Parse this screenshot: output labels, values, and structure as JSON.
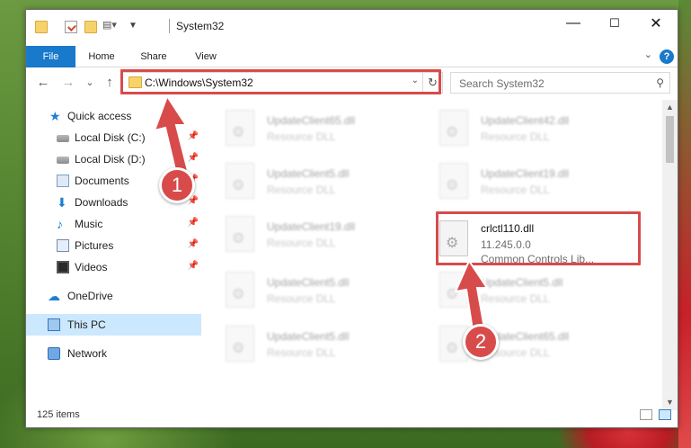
{
  "window": {
    "title": "System32",
    "minimize": "—",
    "maximize": "☐",
    "close": "✕"
  },
  "ribbon": {
    "tabs": [
      "File",
      "Home",
      "Share",
      "View"
    ],
    "help": "?"
  },
  "navigation": {
    "back": "←",
    "forward": "→",
    "recent": "⌄",
    "up": "↑",
    "address": "C:\\Windows\\System32",
    "refresh": "↻",
    "search_placeholder": "Search System32"
  },
  "sidebar": {
    "items": [
      {
        "label": "Quick access",
        "icon": "star-icon"
      },
      {
        "label": "Local Disk (C:)",
        "icon": "disk-icon",
        "pinned": true
      },
      {
        "label": "Local Disk (D:)",
        "icon": "disk-icon",
        "pinned": true
      },
      {
        "label": "Documents",
        "icon": "documents-icon",
        "pinned": true
      },
      {
        "label": "Downloads",
        "icon": "download-icon",
        "pinned": true
      },
      {
        "label": "Music",
        "icon": "music-icon",
        "pinned": true
      },
      {
        "label": "Pictures",
        "icon": "pictures-icon",
        "pinned": true
      },
      {
        "label": "Videos",
        "icon": "videos-icon",
        "pinned": true
      },
      {
        "label": "OneDrive",
        "icon": "cloud-icon"
      },
      {
        "label": "This PC",
        "icon": "pc-icon",
        "selected": true
      },
      {
        "label": "Network",
        "icon": "network-icon"
      }
    ]
  },
  "files": [
    {
      "name": "UpdateClient65.dll",
      "type": "Resource DLL"
    },
    {
      "name": "UpdateClient42.dll",
      "type": "Resource DLL"
    },
    {
      "name": "UpdateClient5.dll",
      "type": "Resource DLL"
    },
    {
      "name": "UpdateClient19.dll",
      "type": "Resource DLL"
    },
    {
      "name": "UpdateClient19.dll",
      "type": "Resource DLL"
    },
    {
      "name": "crlctl110.dll",
      "version": "11.245.0.0",
      "type": "Common Controls Lib..."
    },
    {
      "name": "UpdateClient5.dll",
      "type": "Resource DLL"
    },
    {
      "name": "UpdateClient5.dll",
      "type": "Resource DLL"
    },
    {
      "name": "UpdateClient5.dll",
      "type": "Resource DLL"
    },
    {
      "name": "UpdateClient65.dll",
      "type": "Resource DLL"
    }
  ],
  "status": {
    "item_count": "125 items"
  },
  "annotations": {
    "step1": "1",
    "step2": "2",
    "color": "#d84b4b"
  }
}
